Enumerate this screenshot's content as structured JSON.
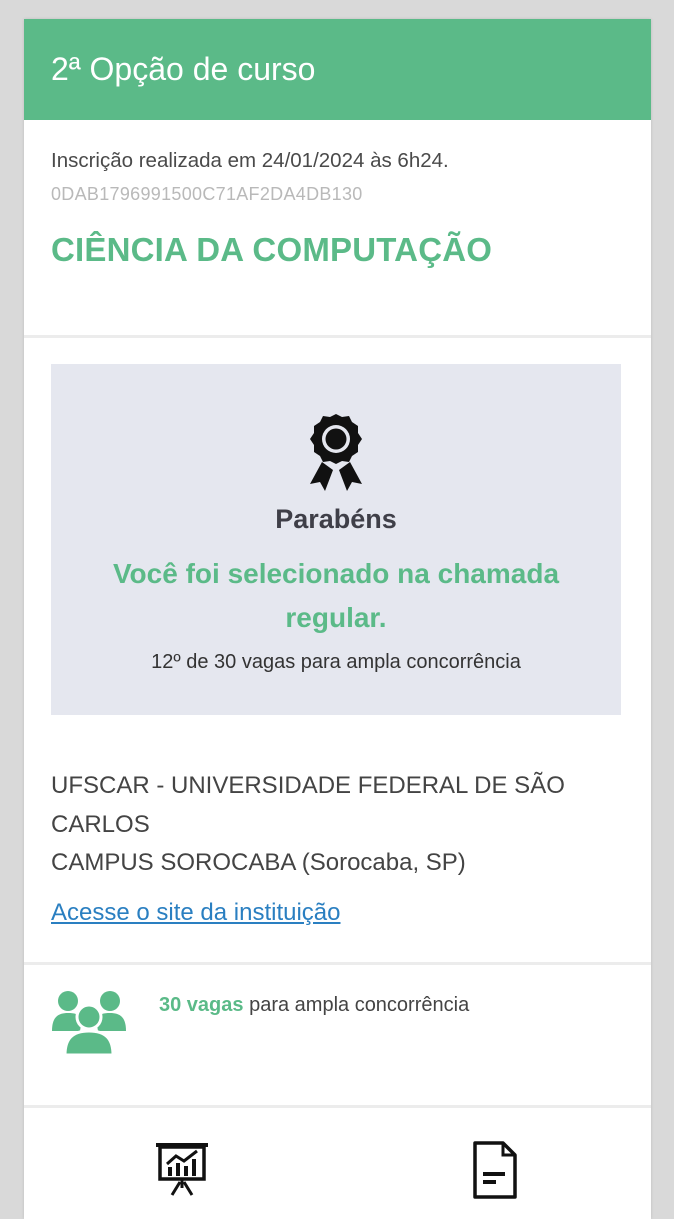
{
  "header": {
    "title": "2ª Opção de curso"
  },
  "registration": {
    "date_text": "Inscrição realizada em 24/01/2024 às 6h24.",
    "code": "0DAB1796991500C71AF2DA4DB130"
  },
  "course": {
    "name": "CIÊNCIA DA COMPUTAÇÃO"
  },
  "result": {
    "icon": "award-icon",
    "title": "Parabéns",
    "message": "Você foi selecionado na chamada regular.",
    "position": "12º de 30 vagas para ampla concorrência"
  },
  "institution": {
    "name": "UFSCAR - UNIVERSIDADE FEDERAL DE SÃO CARLOS",
    "campus": "CAMPUS SOROCABA (Sorocaba, SP)",
    "link_label": "Acesse o site da instituição"
  },
  "vacancies": {
    "icon": "group-icon",
    "count": "30 vagas",
    "label": " para ampla concorrência"
  },
  "bottom_nav": {
    "items": [
      {
        "icon": "presentation-chart-icon"
      },
      {
        "icon": "document-icon"
      }
    ]
  },
  "colors": {
    "accent": "#5bba88",
    "result_background": "#e5e7ef",
    "link": "#2a7fc1"
  }
}
